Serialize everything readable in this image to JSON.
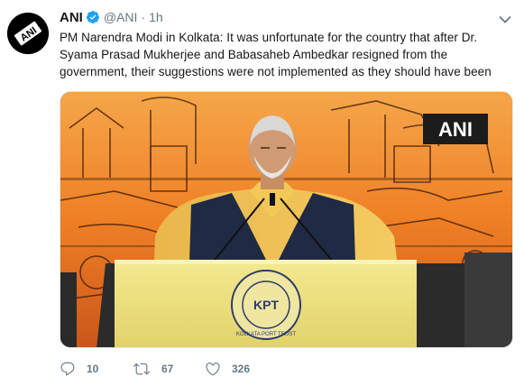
{
  "tweet": {
    "display_name": "ANI",
    "handle": "@ANI",
    "separator": "·",
    "time": "1h",
    "text": "PM Narendra Modi in Kolkata: It was unfortunate for the country that after Dr. Syama Prasad Mukherjee and Babasaheb Ambedkar resigned from the government, their suggestions were not implemented as they should have been",
    "avatar_text": "ANI",
    "media": {
      "watermark": "ANI",
      "podium_seal_text": "KOLKATA PORT TRUST",
      "podium_seal_inner": "KPT"
    },
    "actions": {
      "reply_count": "10",
      "retweet_count": "67",
      "like_count": "326"
    }
  },
  "icons": {
    "verified": "verified-badge-icon",
    "caret": "chevron-down-icon",
    "reply": "reply-icon",
    "retweet": "retweet-icon",
    "like": "heart-icon"
  },
  "colors": {
    "text": "#14171a",
    "secondary": "#657786",
    "verified": "#1da1f2",
    "media_background": "#f08a2c"
  }
}
